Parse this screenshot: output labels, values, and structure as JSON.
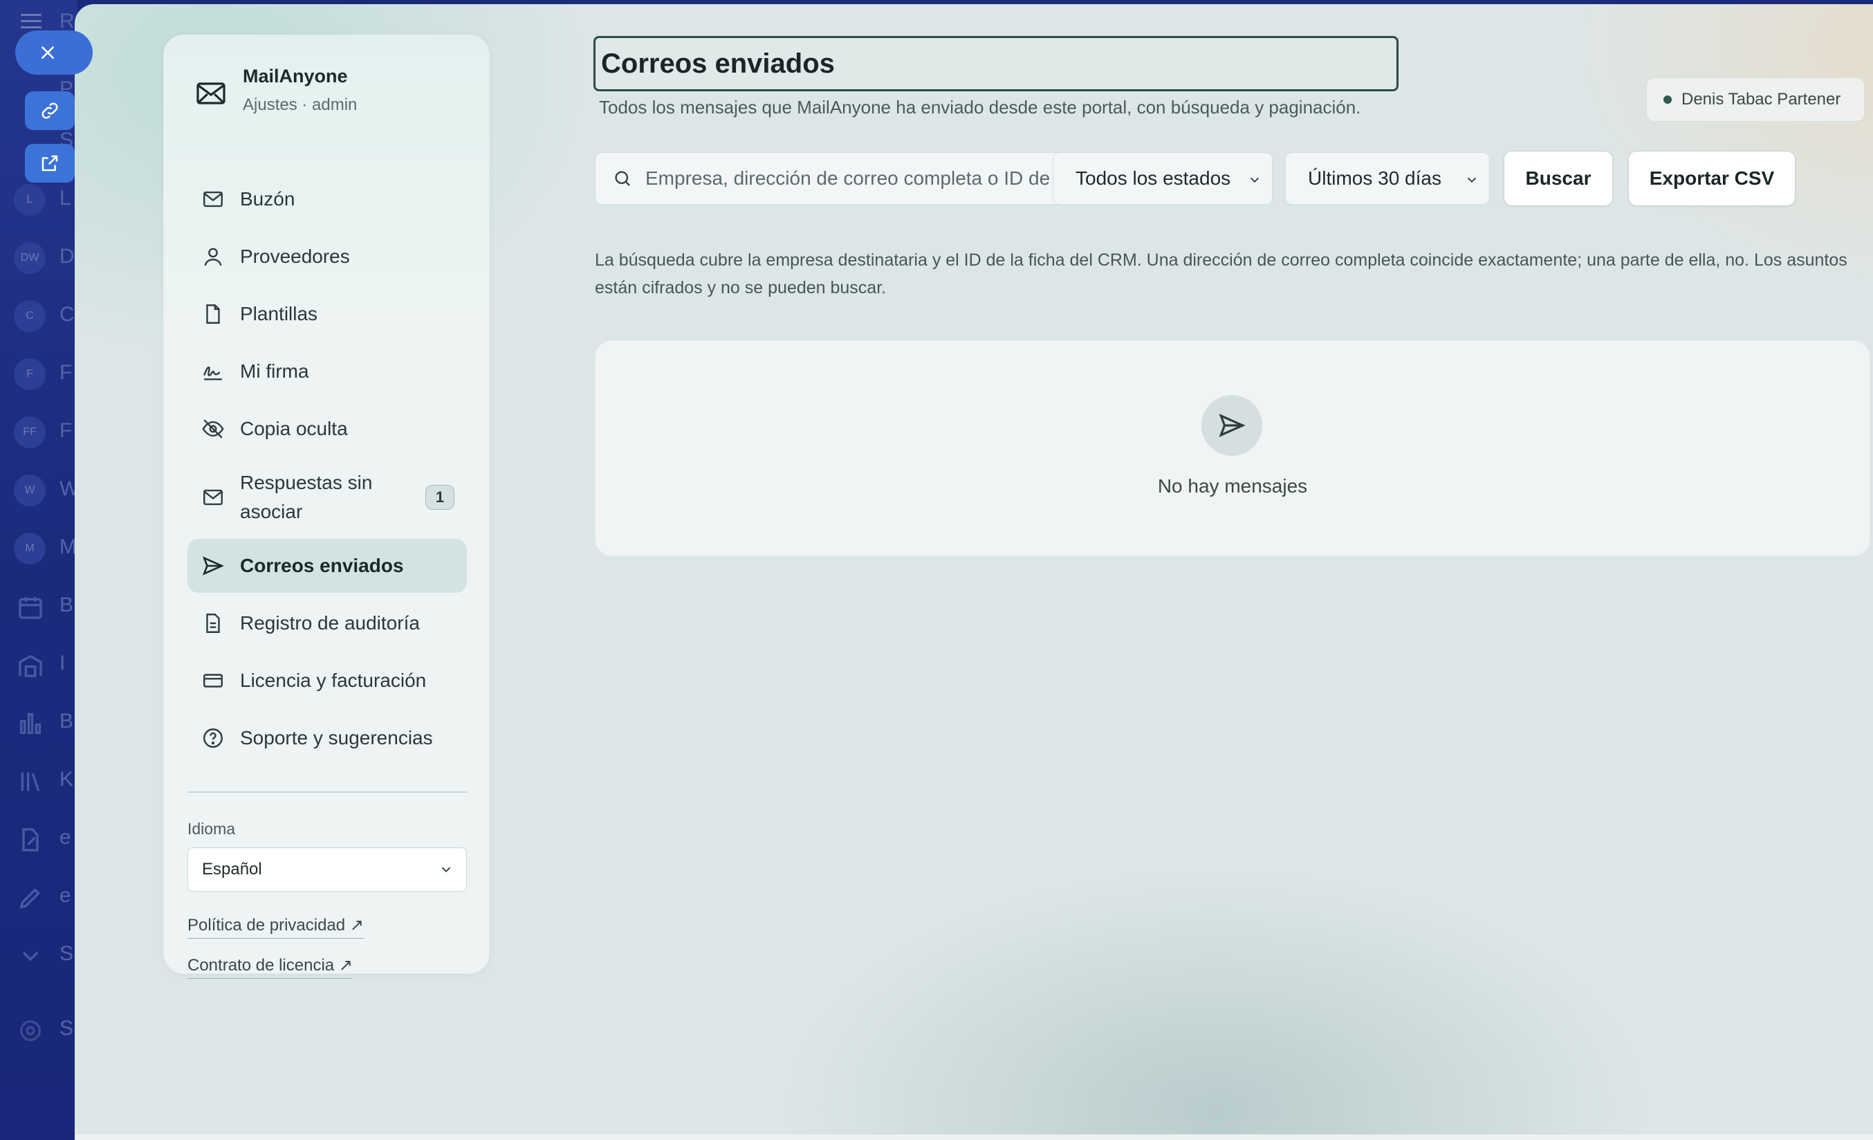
{
  "host": {
    "rail_letters": [
      "R",
      "P",
      "S",
      "L",
      "D",
      "C",
      "F",
      "F",
      "W",
      "M",
      "B",
      "I",
      "B",
      "K",
      "e",
      "e",
      "S",
      "S"
    ],
    "rail_circles": [
      "L",
      "DW",
      "C",
      "F",
      "FF",
      "W",
      "M"
    ]
  },
  "sidebar": {
    "brand_name": "MailAnyone",
    "brand_sub": "Ajustes · admin",
    "items": [
      {
        "label": "Buzón",
        "icon": "mail-icon"
      },
      {
        "label": "Proveedores",
        "icon": "user-icon"
      },
      {
        "label": "Plantillas",
        "icon": "file-icon"
      },
      {
        "label": "Mi firma",
        "icon": "signature-icon"
      },
      {
        "label": "Copia oculta",
        "icon": "eye-off-icon"
      },
      {
        "label": "Respuestas sin asociar",
        "icon": "mail-icon",
        "badge": "1"
      },
      {
        "label": "Correos enviados",
        "icon": "send-icon",
        "active": true
      },
      {
        "label": "Registro de auditoría",
        "icon": "document-icon"
      },
      {
        "label": "Licencia y facturación",
        "icon": "credit-card-icon"
      },
      {
        "label": "Soporte y sugerencias",
        "icon": "help-circle-icon"
      }
    ],
    "language_label": "Idioma",
    "language_value": "Español",
    "privacy_link": "Política de privacidad ↗",
    "license_link": "Contrato de licencia ↗"
  },
  "main": {
    "title": "Correos enviados",
    "subtitle": "Todos los mensajes que MailAnyone ha enviado desde este portal, con búsqueda y paginación.",
    "user_chip": "Denis Tabac Partener",
    "search_placeholder": "Empresa, dirección de correo completa o ID de ficha",
    "status_filter": "Todos los estados",
    "date_filter": "Últimos 30 días",
    "search_button": "Buscar",
    "export_button": "Exportar CSV",
    "help_text": "La búsqueda cubre la empresa destinataria y el ID de la ficha del CRM. Una dirección de correo completa coincide exactamente; una parte de ella, no. Los asuntos están cifrados y no se pueden buscar.",
    "empty_text": "No hay mensajes"
  },
  "colors": {
    "accent": "#3b6fd6",
    "active_nav": "#d3e3e3",
    "status_dot": "#2f5a50"
  }
}
